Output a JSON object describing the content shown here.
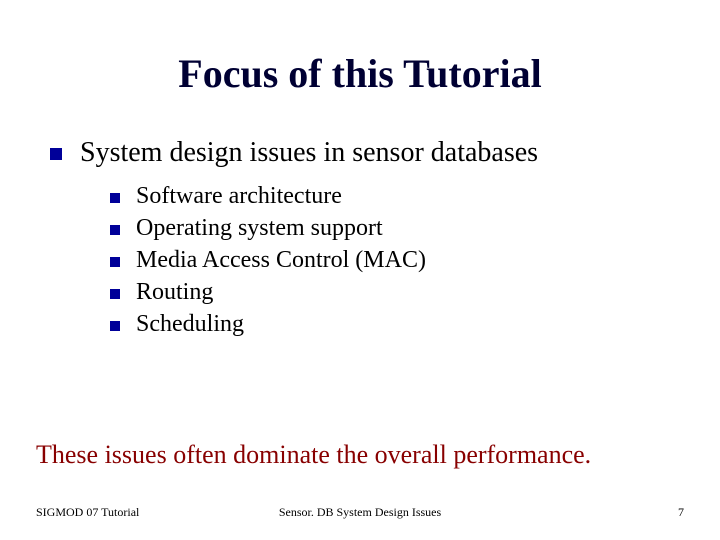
{
  "title": "Focus of this Tutorial",
  "outer": {
    "text": "System design issues in sensor databases"
  },
  "inner": [
    {
      "text": "Software architecture"
    },
    {
      "text": "Operating system support"
    },
    {
      "text": "Media Access Control (MAC)"
    },
    {
      "text": "Routing"
    },
    {
      "text": "Scheduling"
    }
  ],
  "closing": "These issues often dominate the overall performance.",
  "footer": {
    "left": "SIGMOD 07 Tutorial",
    "center": "Sensor. DB System Design Issues",
    "page": "7"
  }
}
